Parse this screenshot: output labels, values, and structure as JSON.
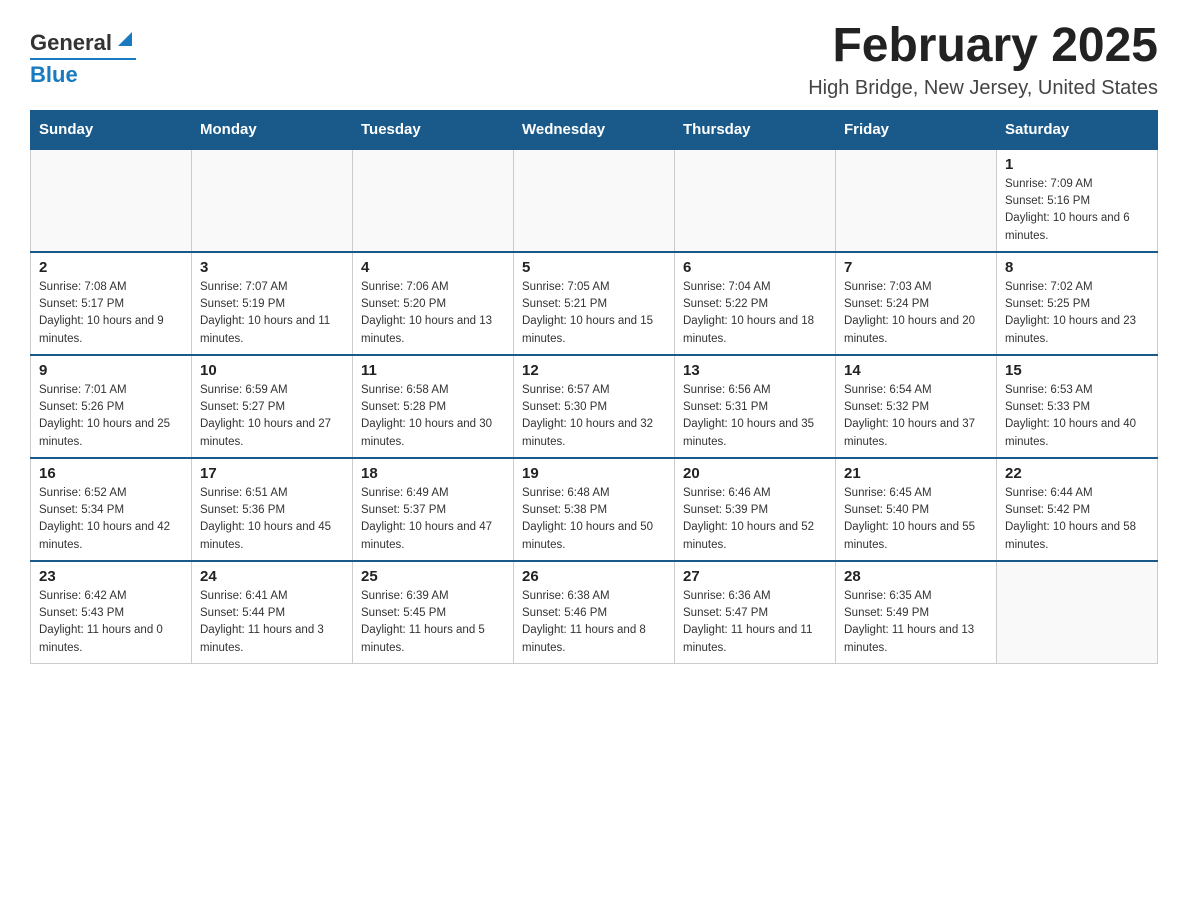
{
  "header": {
    "logo_general": "General",
    "logo_blue": "Blue",
    "month_title": "February 2025",
    "location": "High Bridge, New Jersey, United States"
  },
  "days_of_week": [
    "Sunday",
    "Monday",
    "Tuesday",
    "Wednesday",
    "Thursday",
    "Friday",
    "Saturday"
  ],
  "weeks": [
    [
      {
        "day": "",
        "info": ""
      },
      {
        "day": "",
        "info": ""
      },
      {
        "day": "",
        "info": ""
      },
      {
        "day": "",
        "info": ""
      },
      {
        "day": "",
        "info": ""
      },
      {
        "day": "",
        "info": ""
      },
      {
        "day": "1",
        "info": "Sunrise: 7:09 AM\nSunset: 5:16 PM\nDaylight: 10 hours and 6 minutes."
      }
    ],
    [
      {
        "day": "2",
        "info": "Sunrise: 7:08 AM\nSunset: 5:17 PM\nDaylight: 10 hours and 9 minutes."
      },
      {
        "day": "3",
        "info": "Sunrise: 7:07 AM\nSunset: 5:19 PM\nDaylight: 10 hours and 11 minutes."
      },
      {
        "day": "4",
        "info": "Sunrise: 7:06 AM\nSunset: 5:20 PM\nDaylight: 10 hours and 13 minutes."
      },
      {
        "day": "5",
        "info": "Sunrise: 7:05 AM\nSunset: 5:21 PM\nDaylight: 10 hours and 15 minutes."
      },
      {
        "day": "6",
        "info": "Sunrise: 7:04 AM\nSunset: 5:22 PM\nDaylight: 10 hours and 18 minutes."
      },
      {
        "day": "7",
        "info": "Sunrise: 7:03 AM\nSunset: 5:24 PM\nDaylight: 10 hours and 20 minutes."
      },
      {
        "day": "8",
        "info": "Sunrise: 7:02 AM\nSunset: 5:25 PM\nDaylight: 10 hours and 23 minutes."
      }
    ],
    [
      {
        "day": "9",
        "info": "Sunrise: 7:01 AM\nSunset: 5:26 PM\nDaylight: 10 hours and 25 minutes."
      },
      {
        "day": "10",
        "info": "Sunrise: 6:59 AM\nSunset: 5:27 PM\nDaylight: 10 hours and 27 minutes."
      },
      {
        "day": "11",
        "info": "Sunrise: 6:58 AM\nSunset: 5:28 PM\nDaylight: 10 hours and 30 minutes."
      },
      {
        "day": "12",
        "info": "Sunrise: 6:57 AM\nSunset: 5:30 PM\nDaylight: 10 hours and 32 minutes."
      },
      {
        "day": "13",
        "info": "Sunrise: 6:56 AM\nSunset: 5:31 PM\nDaylight: 10 hours and 35 minutes."
      },
      {
        "day": "14",
        "info": "Sunrise: 6:54 AM\nSunset: 5:32 PM\nDaylight: 10 hours and 37 minutes."
      },
      {
        "day": "15",
        "info": "Sunrise: 6:53 AM\nSunset: 5:33 PM\nDaylight: 10 hours and 40 minutes."
      }
    ],
    [
      {
        "day": "16",
        "info": "Sunrise: 6:52 AM\nSunset: 5:34 PM\nDaylight: 10 hours and 42 minutes."
      },
      {
        "day": "17",
        "info": "Sunrise: 6:51 AM\nSunset: 5:36 PM\nDaylight: 10 hours and 45 minutes."
      },
      {
        "day": "18",
        "info": "Sunrise: 6:49 AM\nSunset: 5:37 PM\nDaylight: 10 hours and 47 minutes."
      },
      {
        "day": "19",
        "info": "Sunrise: 6:48 AM\nSunset: 5:38 PM\nDaylight: 10 hours and 50 minutes."
      },
      {
        "day": "20",
        "info": "Sunrise: 6:46 AM\nSunset: 5:39 PM\nDaylight: 10 hours and 52 minutes."
      },
      {
        "day": "21",
        "info": "Sunrise: 6:45 AM\nSunset: 5:40 PM\nDaylight: 10 hours and 55 minutes."
      },
      {
        "day": "22",
        "info": "Sunrise: 6:44 AM\nSunset: 5:42 PM\nDaylight: 10 hours and 58 minutes."
      }
    ],
    [
      {
        "day": "23",
        "info": "Sunrise: 6:42 AM\nSunset: 5:43 PM\nDaylight: 11 hours and 0 minutes."
      },
      {
        "day": "24",
        "info": "Sunrise: 6:41 AM\nSunset: 5:44 PM\nDaylight: 11 hours and 3 minutes."
      },
      {
        "day": "25",
        "info": "Sunrise: 6:39 AM\nSunset: 5:45 PM\nDaylight: 11 hours and 5 minutes."
      },
      {
        "day": "26",
        "info": "Sunrise: 6:38 AM\nSunset: 5:46 PM\nDaylight: 11 hours and 8 minutes."
      },
      {
        "day": "27",
        "info": "Sunrise: 6:36 AM\nSunset: 5:47 PM\nDaylight: 11 hours and 11 minutes."
      },
      {
        "day": "28",
        "info": "Sunrise: 6:35 AM\nSunset: 5:49 PM\nDaylight: 11 hours and 13 minutes."
      },
      {
        "day": "",
        "info": ""
      }
    ]
  ]
}
